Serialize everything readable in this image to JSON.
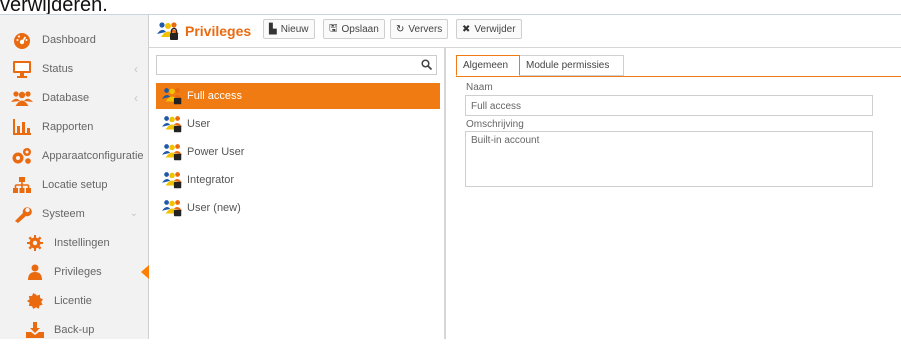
{
  "top_text": "verwijderen.",
  "sidebar": {
    "items": [
      {
        "label": "Dashboard",
        "icon": "dashboard-icon"
      },
      {
        "label": "Status",
        "icon": "monitor-icon"
      },
      {
        "label": "Database",
        "icon": "users-icon"
      },
      {
        "label": "Rapporten",
        "icon": "bar-chart-icon"
      },
      {
        "label": "Apparaatconfiguratie",
        "icon": "cogs-icon"
      },
      {
        "label": "Locatie setup",
        "icon": "sitemap-icon"
      },
      {
        "label": "Systeem",
        "icon": "wrench-icon"
      },
      {
        "label": "Instellingen",
        "icon": "gear-icon"
      },
      {
        "label": "Privileges",
        "icon": "user-icon"
      },
      {
        "label": "Licentie",
        "icon": "certificate-icon"
      },
      {
        "label": "Back-up",
        "icon": "download-icon"
      }
    ]
  },
  "header": {
    "title": "Privileges",
    "buttons": {
      "new": "Nieuw",
      "save": "Opslaan",
      "refresh": "Ververs",
      "delete": "Verwijder"
    }
  },
  "list": {
    "search_value": "",
    "items": [
      "Full access",
      "User",
      "Power User",
      "Integrator",
      "User (new)"
    ],
    "selected": "Full access"
  },
  "detail": {
    "tabs": [
      "Algemeen",
      "Module permissies"
    ],
    "active_tab": "Algemeen",
    "name_label": "Naam",
    "name_value": "Full access",
    "description_label": "Omschrijving",
    "description_value": "Built-in account"
  },
  "colors": {
    "accent": "#f07b12",
    "title": "#ea6a10",
    "sidebar_bg": "#f2f2f2"
  }
}
